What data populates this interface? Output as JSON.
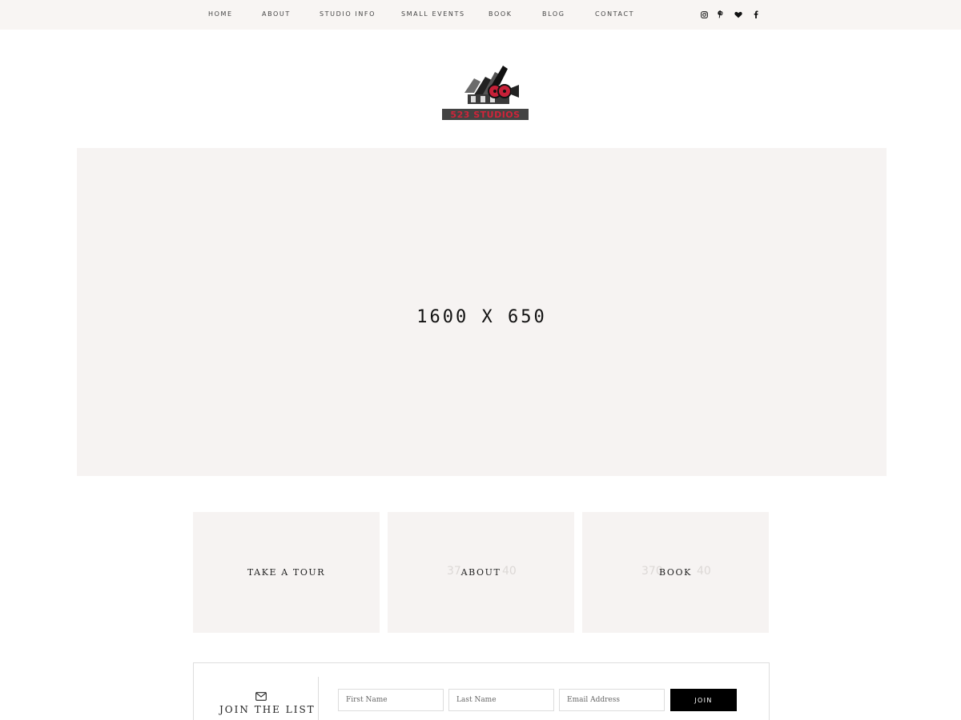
{
  "nav": {
    "items": [
      {
        "label": "HOME"
      },
      {
        "label": "ABOUT"
      },
      {
        "label": "STUDIO INFO"
      },
      {
        "label": "SMALL EVENTS"
      },
      {
        "label": "BOOK"
      },
      {
        "label": "BLOG"
      },
      {
        "label": "CONTACT"
      }
    ],
    "social": [
      "instagram-icon",
      "pinterest-icon",
      "heart-icon",
      "facebook-icon"
    ]
  },
  "logo": {
    "text": "523 STUDIOS",
    "accent_color": "#d0243a"
  },
  "hero": {
    "placeholder_text": "1600 X 650",
    "background": "#f6f3f2"
  },
  "tiles": [
    {
      "label": "TAKE A TOUR",
      "ghost_left": "",
      "ghost_right": ""
    },
    {
      "label": "ABOUT",
      "ghost_left": "37",
      "ghost_right": "40"
    },
    {
      "label": "BOOK",
      "ghost_left": "370",
      "ghost_right": "40"
    }
  ],
  "join": {
    "icon": "envelope-icon",
    "title": "JOIN THE LIST",
    "first_name_placeholder": "First Name",
    "last_name_placeholder": "Last Name",
    "email_placeholder": "Email Address",
    "button_label": "JOIN"
  }
}
